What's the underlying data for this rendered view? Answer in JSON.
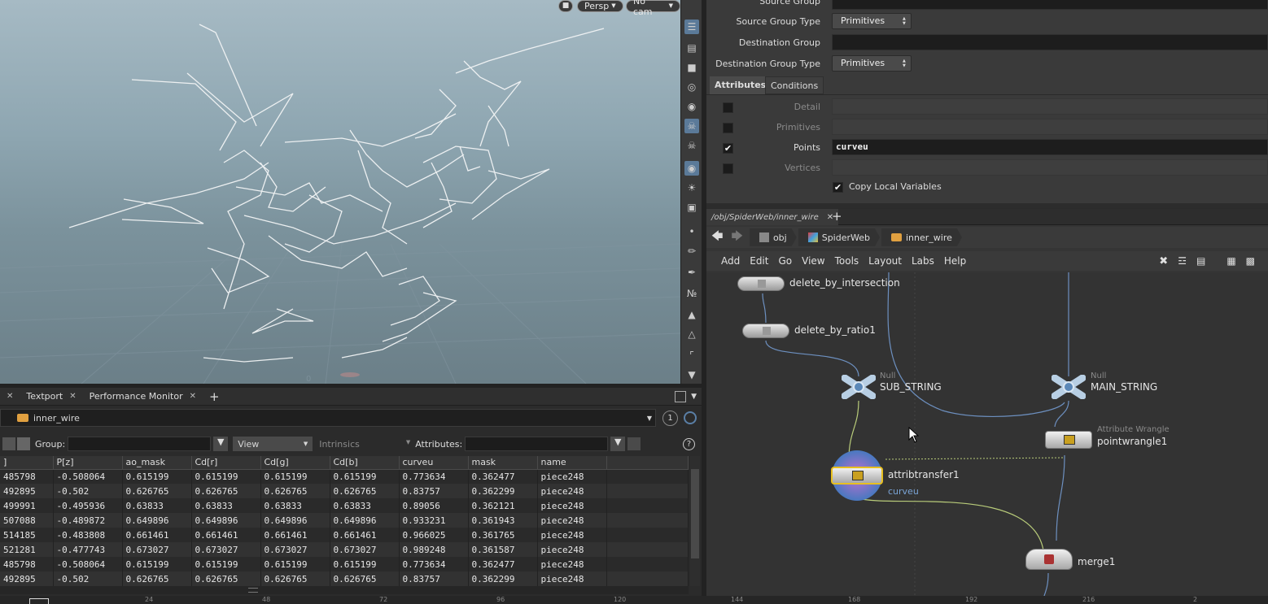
{
  "viewport": {
    "persp_label": "Persp",
    "cam_label": "No cam"
  },
  "bottom_tabs": [
    {
      "label": "Textport"
    },
    {
      "label": "Performance Monitor"
    }
  ],
  "spreadsheet": {
    "node_path": "inner_wire",
    "group_label": "Group:",
    "view_label": "View",
    "intrinsics_label": "Intrinsics",
    "attributes_label": "Attributes:",
    "frame_index": "1",
    "columns": [
      "]",
      "P[z]",
      "ao_mask",
      "Cd[r]",
      "Cd[g]",
      "Cd[b]",
      "curveu",
      "mask",
      "name"
    ],
    "rows": [
      [
        "485798",
        "-0.508064",
        "0.615199",
        "0.615199",
        "0.615199",
        "0.615199",
        "0.773634",
        "0.362477",
        "piece248"
      ],
      [
        "492895",
        "-0.502",
        "0.626765",
        "0.626765",
        "0.626765",
        "0.626765",
        "0.83757",
        "0.362299",
        "piece248"
      ],
      [
        "499991",
        "-0.495936",
        "0.63833",
        "0.63833",
        "0.63833",
        "0.63833",
        "0.89056",
        "0.362121",
        "piece248"
      ],
      [
        "507088",
        "-0.489872",
        "0.649896",
        "0.649896",
        "0.649896",
        "0.649896",
        "0.933231",
        "0.361943",
        "piece248"
      ],
      [
        "514185",
        "-0.483808",
        "0.661461",
        "0.661461",
        "0.661461",
        "0.661461",
        "0.966025",
        "0.361765",
        "piece248"
      ],
      [
        "521281",
        "-0.477743",
        "0.673027",
        "0.673027",
        "0.673027",
        "0.673027",
        "0.989248",
        "0.361587",
        "piece248"
      ],
      [
        "485798",
        "-0.508064",
        "0.615199",
        "0.615199",
        "0.615199",
        "0.615199",
        "0.773634",
        "0.362477",
        "piece248"
      ],
      [
        "492895",
        "-0.502",
        "0.626765",
        "0.626765",
        "0.626765",
        "0.626765",
        "0.83757",
        "0.362299",
        "piece248"
      ]
    ]
  },
  "params": {
    "source_group_label": "Source Group",
    "source_group_type_label": "Source Group Type",
    "source_group_type_value": "Primitives",
    "destination_group_label": "Destination Group",
    "destination_group_type_label": "Destination Group Type",
    "destination_group_type_value": "Primitives",
    "tabs": [
      "Attributes",
      "Conditions"
    ],
    "detail_label": "Detail",
    "primitives_label": "Primitives",
    "points_label": "Points",
    "points_value": "curveu",
    "vertices_label": "Vertices",
    "copy_local_label": "Copy Local Variables"
  },
  "network": {
    "tab_label": "/obj/SpiderWeb/inner_wire",
    "crumbs": [
      "obj",
      "SpiderWeb",
      "inner_wire"
    ],
    "menu": [
      "Add",
      "Edit",
      "Go",
      "View",
      "Tools",
      "Layout",
      "Labs",
      "Help"
    ],
    "nodes": {
      "delete_by_intersection": "delete_by_intersection",
      "delete_by_ratio1": "delete_by_ratio1",
      "sub_string_type": "Null",
      "sub_string": "SUB_STRING",
      "main_string_type": "Null",
      "main_string": "MAIN_STRING",
      "wrangle_type": "Attribute Wrangle",
      "wrangle": "pointwrangle1",
      "attribtransfer": "attribtransfer1",
      "attribtransfer_sub": "curveu",
      "merge": "merge1"
    }
  },
  "timeline": {
    "ticks": [
      "24",
      "48",
      "72",
      "96",
      "120",
      "144",
      "168",
      "192",
      "216",
      "2"
    ]
  }
}
